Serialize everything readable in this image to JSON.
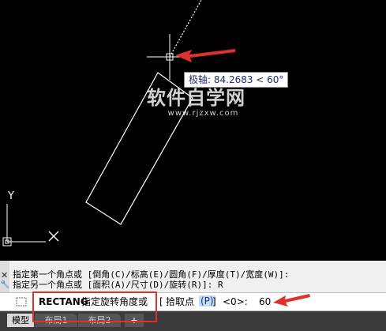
{
  "viewport": {
    "tooltip": {
      "label": "极轴: 84.2683 < 60°"
    },
    "watermark": {
      "title": "软件自学网",
      "url": "www.rjzxw.com"
    }
  },
  "command_history": [
    "指定第一个角点或 [倒角(C)/标高(E)/圆角(F)/厚度(T)/宽度(W)]:",
    "指定另一个角点或 [面积(A)/尺寸(D)/旋转(R)]: R"
  ],
  "command_line": {
    "command_name": "RECTANG",
    "prompt": "指定旋转角度或",
    "option_open": "[",
    "option_label": "拾取点",
    "option_key": "(P)",
    "option_close": "]",
    "default_value": "<0>:",
    "input_value": "60"
  },
  "tabs": [
    {
      "label": "模型"
    },
    {
      "label": "布局1"
    },
    {
      "label": "布局2"
    },
    {
      "label": "+"
    }
  ],
  "colors": {
    "canvas_bg": "#000000",
    "annotation_red": "#e0302e",
    "option_highlight": "#c5daf3"
  }
}
